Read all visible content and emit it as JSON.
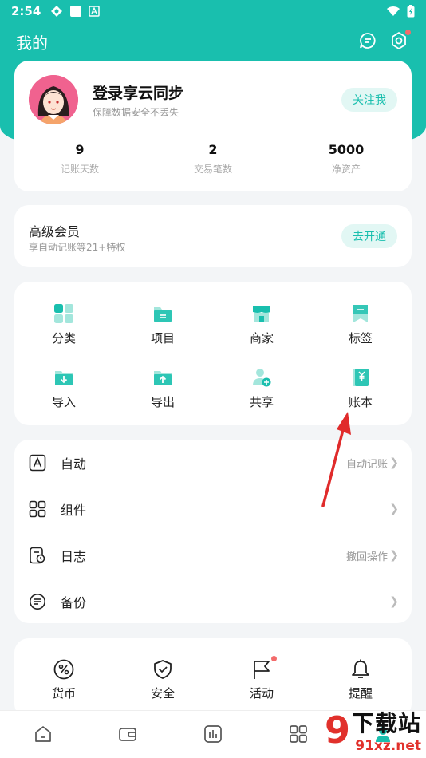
{
  "status_bar": {
    "time": "2:54"
  },
  "header": {
    "title": "我的"
  },
  "profile": {
    "name": "登录享云同步",
    "subtitle": "保障数据安全不丢失",
    "follow_label": "关注我",
    "stats": [
      {
        "value": "9",
        "label": "记账天数"
      },
      {
        "value": "2",
        "label": "交易笔数"
      },
      {
        "value": "5000",
        "label": "净资产"
      }
    ]
  },
  "vip": {
    "title": "高级会员",
    "subtitle": "享自动记账等21+特权",
    "button": "去开通"
  },
  "grid": [
    {
      "label": "分类",
      "icon": "category-icon"
    },
    {
      "label": "项目",
      "icon": "folder-icon"
    },
    {
      "label": "商家",
      "icon": "store-icon"
    },
    {
      "label": "标签",
      "icon": "bookmark-icon"
    },
    {
      "label": "导入",
      "icon": "import-icon"
    },
    {
      "label": "导出",
      "icon": "export-icon"
    },
    {
      "label": "共享",
      "icon": "share-user-icon"
    },
    {
      "label": "账本",
      "icon": "ledger-icon"
    }
  ],
  "menu": [
    {
      "label": "自动",
      "extra": "自动记账",
      "icon": "auto-icon"
    },
    {
      "label": "组件",
      "extra": "",
      "icon": "widgets-icon"
    },
    {
      "label": "日志",
      "extra": "撤回操作",
      "icon": "log-icon"
    },
    {
      "label": "备份",
      "extra": "",
      "icon": "backup-icon"
    }
  ],
  "bottom": [
    {
      "label": "货币",
      "icon": "percent-icon"
    },
    {
      "label": "安全",
      "icon": "shield-icon"
    },
    {
      "label": "活动",
      "icon": "flag-icon"
    },
    {
      "label": "提醒",
      "icon": "bell-icon"
    }
  ],
  "watermark": {
    "logo": "9",
    "name": "下载站",
    "url": "91xz.net"
  },
  "colors": {
    "accent": "#19bfae",
    "red_dot": "#f36b6b",
    "annotation_arrow": "#e02b2b"
  }
}
